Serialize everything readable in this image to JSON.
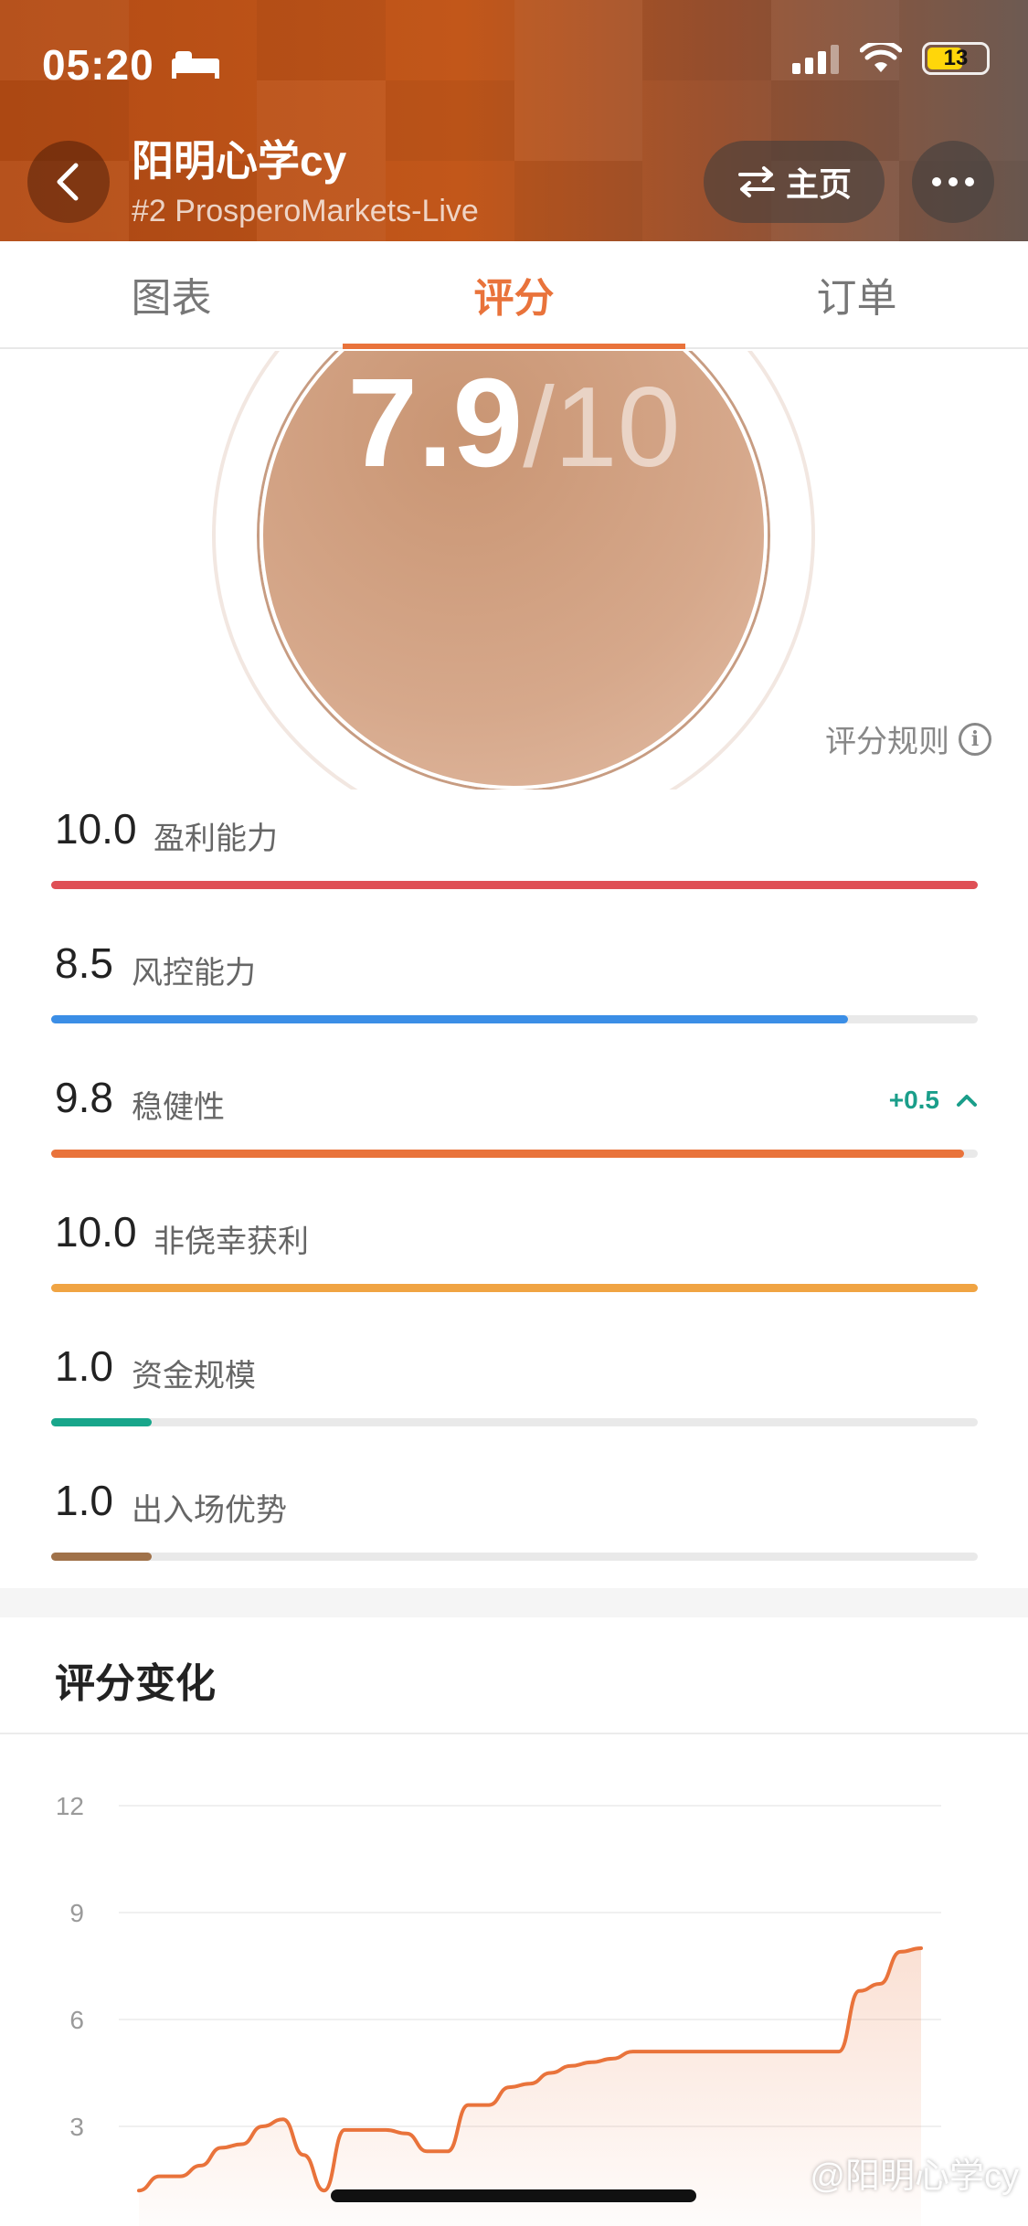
{
  "status_bar": {
    "time": "05:20",
    "battery": "13"
  },
  "header": {
    "title": "阳明心学cy",
    "subtitle": "#2 ProsperoMarkets-Live",
    "home_button": "主页"
  },
  "tabs": [
    {
      "label": "图表",
      "active": false
    },
    {
      "label": "评分",
      "active": true
    },
    {
      "label": "订单",
      "active": false
    }
  ],
  "score": {
    "value": "7.9",
    "max": "/10"
  },
  "rule_link": "评分规则",
  "metrics": [
    {
      "value": "10.0",
      "label": "盈利能力",
      "fraction": 1.0,
      "color": "#df4f55"
    },
    {
      "value": "8.5",
      "label": "风控能力",
      "fraction": 0.86,
      "color": "#3b8ee6"
    },
    {
      "value": "9.8",
      "label": "稳健性",
      "fraction": 0.985,
      "color": "#e9733b",
      "delta": "+0.5"
    },
    {
      "value": "10.0",
      "label": "非侥幸获利",
      "fraction": 1.0,
      "color": "#f0a443"
    },
    {
      "value": "1.0",
      "label": "资金规模",
      "fraction": 0.108,
      "color": "#18a68b"
    },
    {
      "value": "1.0",
      "label": "出入场优势",
      "fraction": 0.108,
      "color": "#a0724a"
    }
  ],
  "section_title": "评分变化",
  "chart_data": {
    "type": "area",
    "yticks": [
      "12",
      "9",
      "6",
      "3"
    ],
    "ylim": [
      0,
      12
    ],
    "color": "#e9733b",
    "values": [
      1.2,
      1.6,
      1.6,
      1.9,
      2.4,
      2.5,
      3.0,
      3.2,
      2.2,
      1.2,
      2.9,
      2.9,
      2.9,
      2.8,
      2.3,
      2.3,
      3.6,
      3.6,
      4.1,
      4.2,
      4.5,
      4.7,
      4.8,
      4.9,
      5.1,
      5.1,
      5.1,
      5.1,
      5.1,
      5.1,
      5.1,
      5.1,
      5.1,
      5.1,
      5.1,
      6.8,
      7.0,
      7.9,
      8.0
    ]
  },
  "watermark": "@阳明心学cy"
}
